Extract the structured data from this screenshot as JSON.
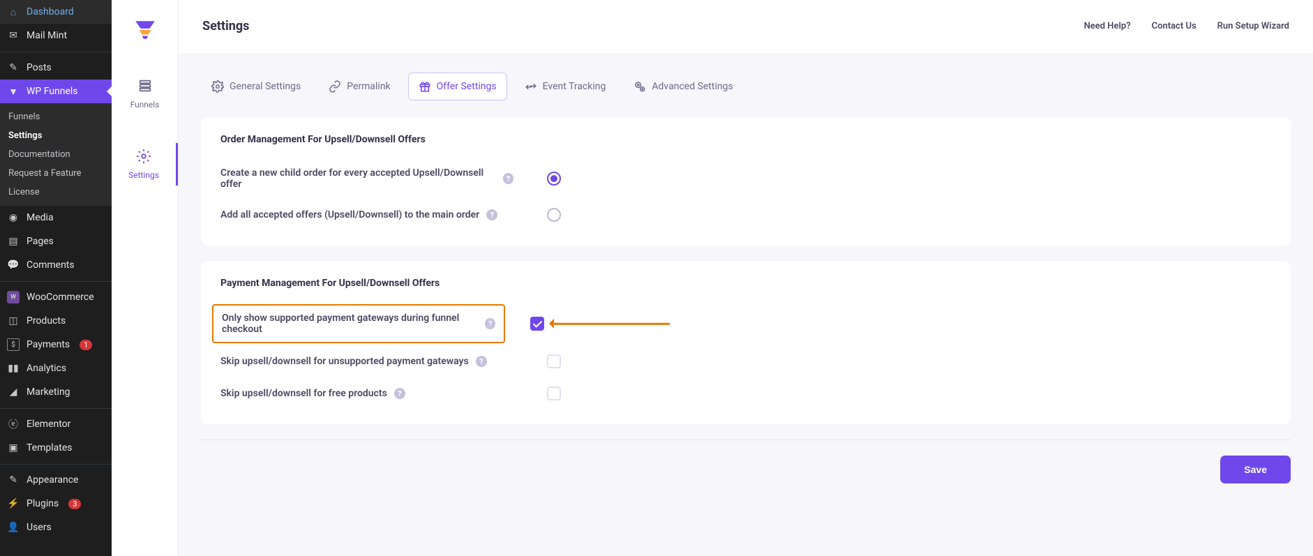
{
  "wp_sidebar": {
    "items": [
      {
        "label": "Dashboard",
        "icon": "gauge"
      },
      {
        "label": "Mail Mint",
        "icon": "envelope"
      },
      {
        "label": "Posts",
        "icon": "pin"
      },
      {
        "label": "WP Funnels",
        "icon": "target",
        "active_plugin": true
      },
      {
        "label": "Media",
        "icon": "camera"
      },
      {
        "label": "Pages",
        "icon": "page"
      },
      {
        "label": "Comments",
        "icon": "chat"
      },
      {
        "label": "WooCommerce",
        "icon": "woo"
      },
      {
        "label": "Products",
        "icon": "box"
      },
      {
        "label": "Payments",
        "icon": "dollar",
        "badge": "1"
      },
      {
        "label": "Analytics",
        "icon": "bars"
      },
      {
        "label": "Marketing",
        "icon": "megaphone"
      },
      {
        "label": "Elementor",
        "icon": "elementor"
      },
      {
        "label": "Templates",
        "icon": "stack"
      },
      {
        "label": "Appearance",
        "icon": "brush"
      },
      {
        "label": "Plugins",
        "icon": "plug",
        "badge": "3"
      },
      {
        "label": "Users",
        "icon": "user"
      }
    ],
    "sub_items": [
      {
        "label": "Funnels"
      },
      {
        "label": "Settings",
        "active": true
      },
      {
        "label": "Documentation"
      },
      {
        "label": "Request a Feature"
      },
      {
        "label": "License"
      }
    ]
  },
  "rail": {
    "items": [
      {
        "label": "Funnels",
        "icon": "list"
      },
      {
        "label": "Settings",
        "icon": "gear",
        "active": true
      }
    ]
  },
  "topbar": {
    "title": "Settings",
    "links": [
      {
        "label": "Need Help?"
      },
      {
        "label": "Contact Us"
      },
      {
        "label": "Run Setup Wizard"
      }
    ]
  },
  "tabs": [
    {
      "label": "General Settings",
      "icon": "gear"
    },
    {
      "label": "Permalink",
      "icon": "link"
    },
    {
      "label": "Offer Settings",
      "icon": "gift",
      "active": true
    },
    {
      "label": "Event Tracking",
      "icon": "arrows"
    },
    {
      "label": "Advanced Settings",
      "icon": "cogs"
    }
  ],
  "cards": {
    "order_mgmt": {
      "title": "Order Management For Upsell/Downsell Offers",
      "options": [
        {
          "label": "Create a new child order for every accepted Upsell/Downsell offer",
          "type": "radio",
          "selected": true
        },
        {
          "label": "Add all accepted offers (Upsell/Downsell) to the main order",
          "type": "radio",
          "selected": false
        }
      ]
    },
    "pay_mgmt": {
      "title": "Payment Management For Upsell/Downsell Offers",
      "options": [
        {
          "label": "Only show supported payment gateways during funnel checkout",
          "type": "checkbox",
          "checked": true,
          "highlighted": true,
          "arrow": true
        },
        {
          "label": "Skip upsell/downsell for unsupported payment gateways",
          "type": "checkbox",
          "checked": false
        },
        {
          "label": "Skip upsell/downsell for free products",
          "type": "checkbox",
          "checked": false
        }
      ]
    }
  },
  "save_label": "Save",
  "icons": {
    "gauge": "◑",
    "envelope": "✉",
    "pin": "📌",
    "target": "◎",
    "camera": "🎵",
    "page": "▤",
    "chat": "💬",
    "woo": "w",
    "box": "📦",
    "dollar": "$",
    "bars": "📊",
    "megaphone": "📣",
    "elementor": "ⓔ",
    "stack": "▣",
    "brush": "🖌",
    "plug": "🔌",
    "user": "👤"
  }
}
